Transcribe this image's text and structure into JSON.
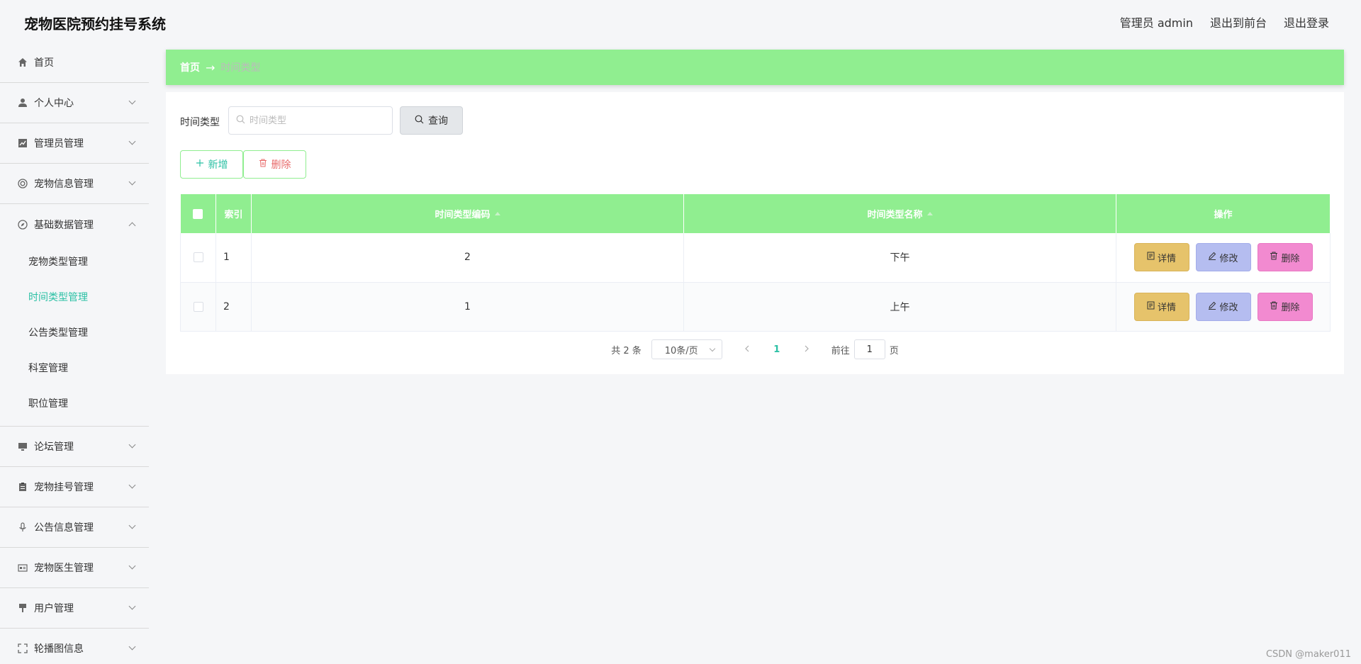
{
  "app": {
    "title": "宠物医院预约挂号系统",
    "user_label": "管理员 admin",
    "exit_front": "退出到前台",
    "logout": "退出登录"
  },
  "sidebar": {
    "items": [
      {
        "label": "首页",
        "icon": "home-icon"
      },
      {
        "label": "个人中心",
        "icon": "user-icon"
      },
      {
        "label": "管理员管理",
        "icon": "chart-icon"
      },
      {
        "label": "宠物信息管理",
        "icon": "lifebuoy-icon"
      },
      {
        "label": "基础数据管理",
        "icon": "compass-icon",
        "expanded": true
      },
      {
        "label": "论坛管理",
        "icon": "monitor-icon"
      },
      {
        "label": "宠物挂号管理",
        "icon": "clipboard-icon"
      },
      {
        "label": "公告信息管理",
        "icon": "microphone-icon"
      },
      {
        "label": "宠物医生管理",
        "icon": "id-card-icon"
      },
      {
        "label": "用户管理",
        "icon": "brush-icon"
      },
      {
        "label": "轮播图信息",
        "icon": "fullscreen-icon"
      }
    ],
    "submenu": [
      {
        "label": "宠物类型管理"
      },
      {
        "label": "时间类型管理",
        "active": true
      },
      {
        "label": "公告类型管理"
      },
      {
        "label": "科室管理"
      },
      {
        "label": "职位管理"
      }
    ]
  },
  "breadcrumb": {
    "home": "首页",
    "arrow": "→",
    "current": "时间类型"
  },
  "search": {
    "label": "时间类型",
    "placeholder": "时间类型",
    "button": "查询"
  },
  "toolbar": {
    "add": "新增",
    "delete": "删除"
  },
  "table": {
    "headers": {
      "index": "索引",
      "code": "时间类型编码",
      "name": "时间类型名称",
      "actions": "操作"
    },
    "rows": [
      {
        "index": "1",
        "code": "2",
        "name": "下午"
      },
      {
        "index": "2",
        "code": "1",
        "name": "上午"
      }
    ],
    "row_actions": {
      "detail": "详情",
      "edit": "修改",
      "delete": "删除"
    }
  },
  "pagination": {
    "total": "共 2 条",
    "page_size": "10条/页",
    "current_page": "1",
    "goto_prefix": "前往",
    "goto_value": "1",
    "goto_suffix": "页"
  },
  "watermark": "CSDN @maker011",
  "colors": {
    "accent": "#90ee90",
    "active_text": "#2bc0a4",
    "detail_btn": "#e6c36b",
    "edit_btn": "#b5bdf0",
    "delete_btn": "#f28ad0"
  }
}
